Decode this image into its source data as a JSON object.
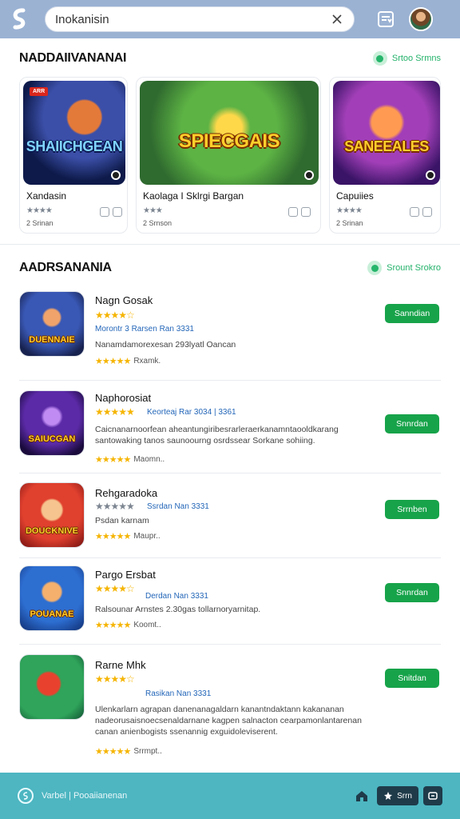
{
  "search": {
    "value": "Inokanisin"
  },
  "featured_section": {
    "title": "NADDAIIVANANAI",
    "link_label": "Srtoo Srmns"
  },
  "featured": [
    {
      "art_title": "SHAIICHGEAN",
      "badge": "ARR",
      "name": "Xandasin",
      "rating_text": "★★★★",
      "size": "2 Srinan"
    },
    {
      "art_title": "SPIECGAIS",
      "name": "Kaolaga I Sklrgi Bargan",
      "rating_text": "★★★",
      "size": "2 Srnson"
    },
    {
      "art_title": "SANEEALES",
      "name": "Capuiies",
      "rating_text": "★★★★",
      "size": "2 Srinan"
    }
  ],
  "list_section": {
    "title": "AADRSANANIA",
    "link_label": "Srount Srokro"
  },
  "list": [
    {
      "title": "Nagn Gosak",
      "icon_label": "DUENNAIE",
      "stars": "★★★★☆",
      "meta": "Morontr 3 Rarsen  Ran 3331",
      "desc": "Nanamdamorexesan 293lyatl Oancan",
      "foot": "Rxamk.",
      "button": "Sanndian"
    },
    {
      "title": "Naphorosiat",
      "icon_label": "SAIUCGAN",
      "stars": "★★★★★",
      "meta": "Keorteaj  Rar 3034 | 3361",
      "desc": "Caicnanarnoorfean aheantungiribesrarleraerkanamntaooldkarang santowaking tanos saunoourng osrdssear Sorkane sohiing.",
      "foot": "Maomn..",
      "button": "Snnrdan"
    },
    {
      "title": "Rehgaradoka",
      "icon_label": "DOUCKNIVE",
      "stars": "★★★★★",
      "meta": "Ssrdan  Nan 3331",
      "desc": "Psdan karnam",
      "foot": "Maupr..",
      "button": "Srrnben"
    },
    {
      "title": "Pargo Ersbat",
      "icon_label": "POUANAE",
      "stars": "★★★★☆",
      "meta": "Derdan  Nan 3331",
      "desc": "Ralsounar Arnstes 2.30gas tollarnoryarnitap.",
      "foot": "Koomt..",
      "button": "Snnrdan"
    },
    {
      "title": "Rarne Mhk",
      "icon_label": "",
      "stars": "★★★★☆",
      "meta": "Rasikan  Nan 3331",
      "desc": "Ulenkarlarn agrapan danenanagaldarn kanantndaktann kakananan nadeorusaisnoecsenaldarnane kagpen salnacton cearpamonlantarenan canan anienbogists ssenannig exguidoleviserent.",
      "foot": "Srrmpt..",
      "button": "Snitdan"
    }
  ],
  "bottom": {
    "text": "Varbel | Pooaiianenan",
    "pill": "Srrn"
  }
}
